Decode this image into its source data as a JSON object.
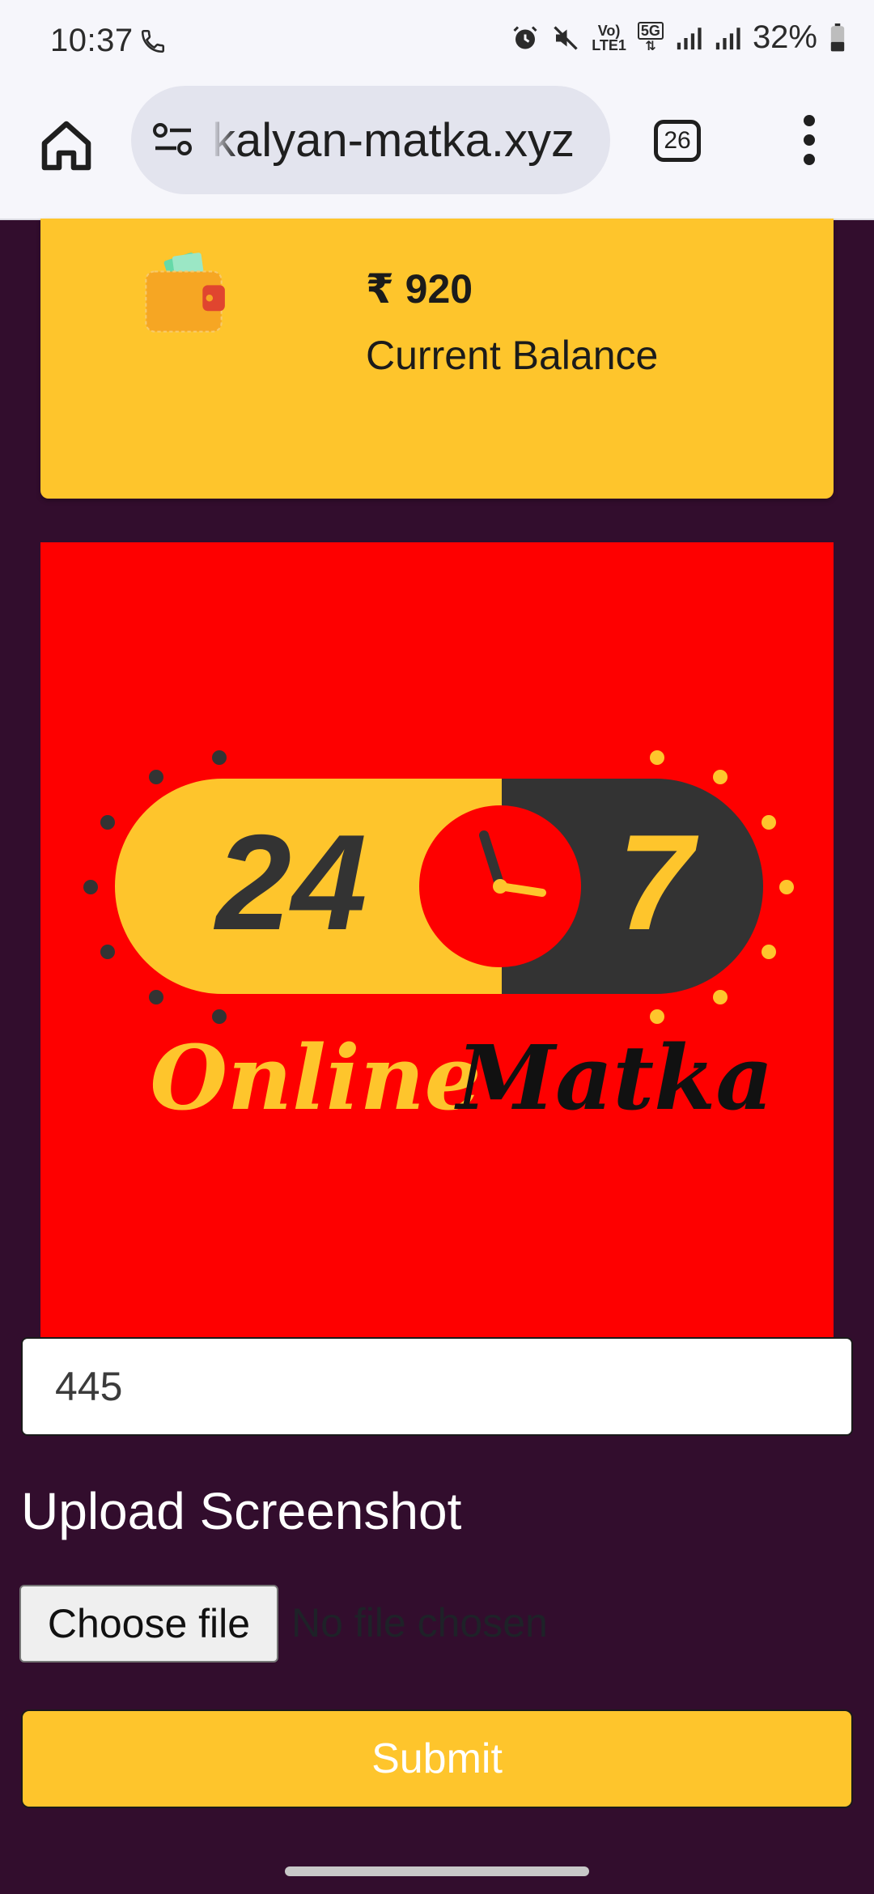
{
  "status": {
    "time": "10:37",
    "net_top": "Vo)",
    "net_bottom": "LTE1",
    "five_g": "5G",
    "battery": "32%"
  },
  "browser": {
    "url": "kalyan-matka.xyz",
    "tab_count": "26"
  },
  "balance": {
    "amount": "₹ 920",
    "label": "Current Balance"
  },
  "logo": {
    "num_left": "24",
    "num_right": "7",
    "word_left": "Online",
    "word_right": "Matka"
  },
  "form": {
    "amount_value": "445",
    "upload_heading": "Upload Screenshot",
    "choose_file_label": "Choose file",
    "no_file_text": "No file chosen",
    "submit_label": "Submit"
  },
  "colors": {
    "page_bg": "#320d2d",
    "accent_yellow": "#fec52c",
    "logo_red": "#fe0000",
    "logo_dark": "#333333"
  }
}
